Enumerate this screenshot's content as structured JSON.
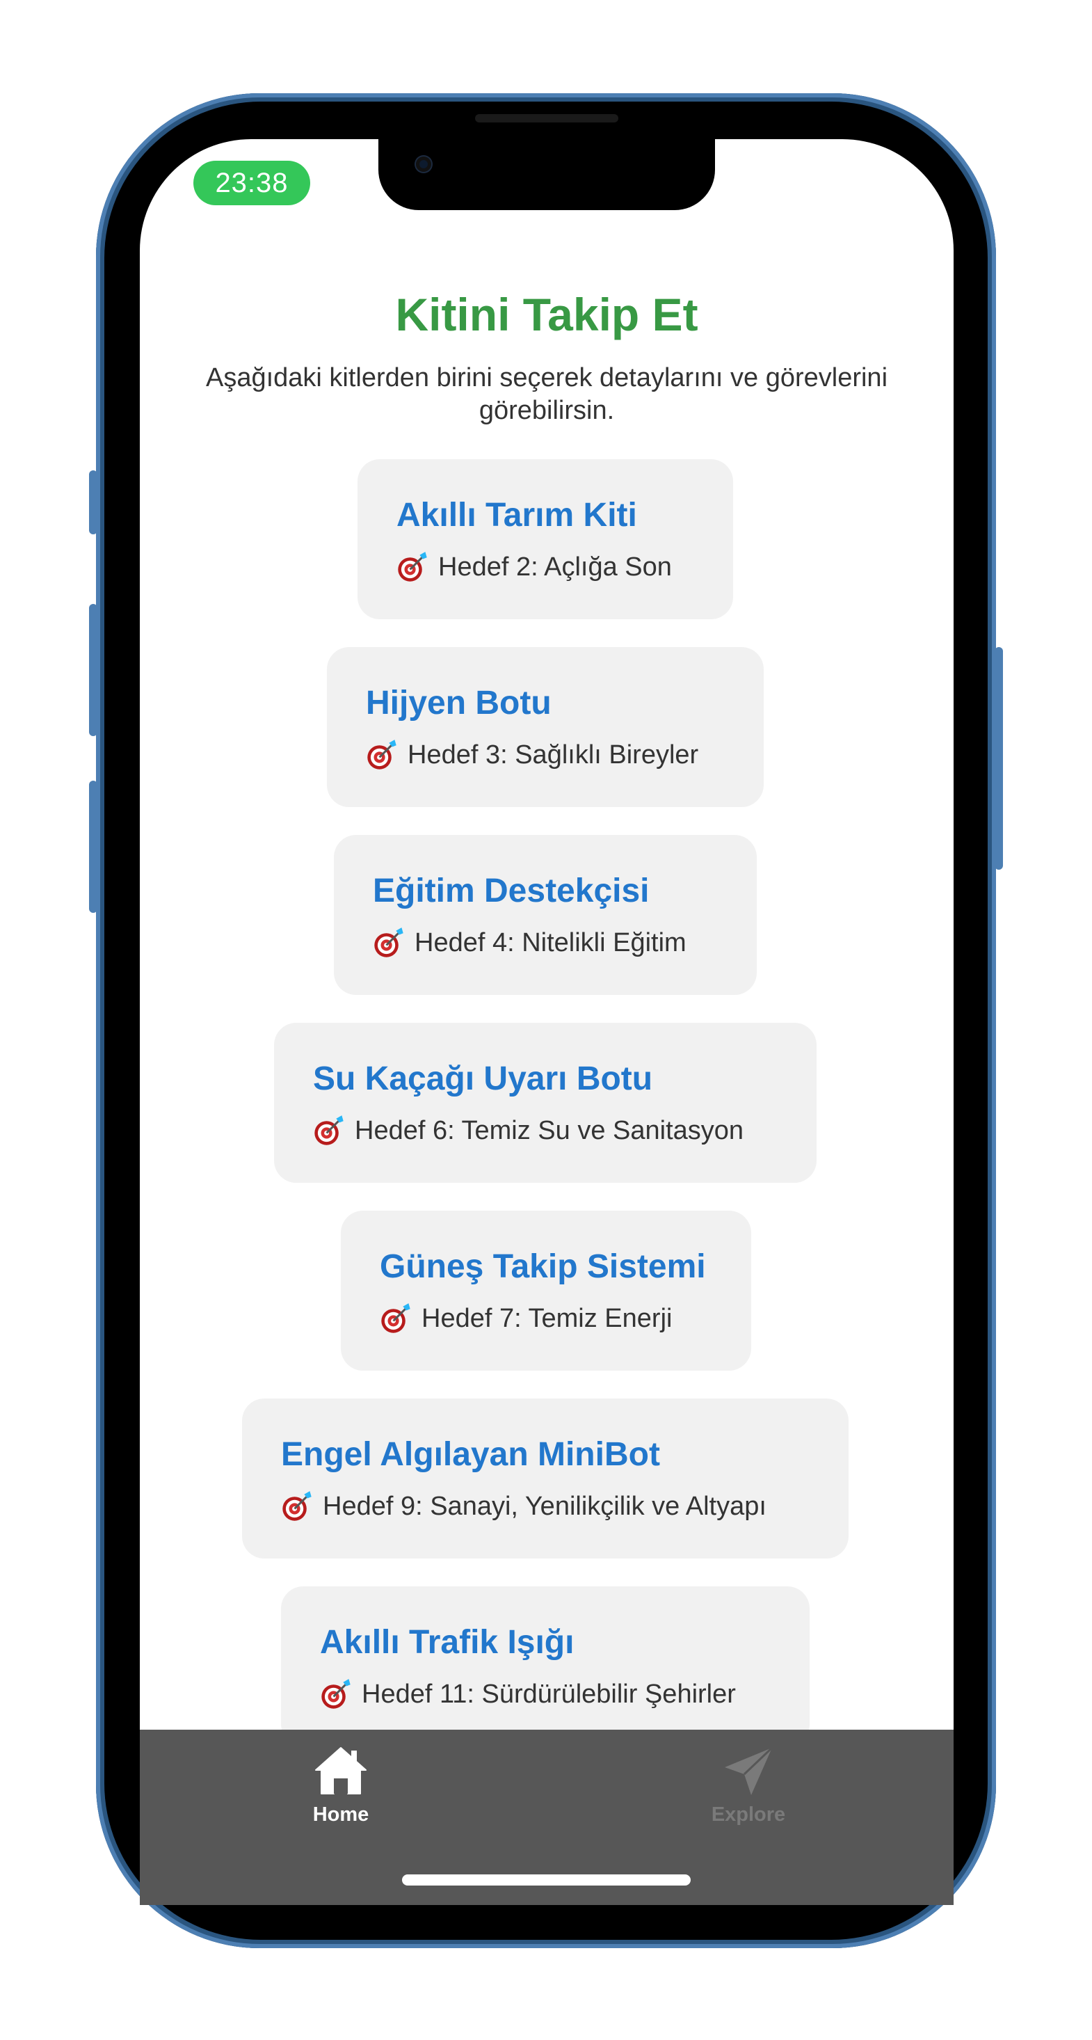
{
  "status_bar": {
    "time": "23:38"
  },
  "header": {
    "title": "Kitini Takip Et",
    "subtitle": "Aşağıdaki kitlerden birini seçerek detaylarını ve görevlerini görebilirsin."
  },
  "kits": [
    {
      "name": "Akıllı Tarım Kiti",
      "goal": "Hedef 2: Açlığa Son"
    },
    {
      "name": "Hijyen Botu",
      "goal": "Hedef 3: Sağlıklı Bireyler"
    },
    {
      "name": "Eğitim Destekçisi",
      "goal": "Hedef 4: Nitelikli Eğitim"
    },
    {
      "name": "Su Kaçağı Uyarı Botu",
      "goal": "Hedef 6: Temiz Su ve Sanitasyon"
    },
    {
      "name": "Güneş Takip Sistemi",
      "goal": "Hedef 7: Temiz Enerji"
    },
    {
      "name": "Engel Algılayan MiniBot",
      "goal": "Hedef 9: Sanayi, Yenilikçilik ve Altyapı"
    },
    {
      "name": "Akıllı Trafik Işığı",
      "goal": "Hedef 11: Sürdürülebilir Şehirler"
    }
  ],
  "tab_bar": {
    "tabs": [
      {
        "label": "Home",
        "icon": "home-icon",
        "active": true
      },
      {
        "label": "Explore",
        "icon": "paper-plane-icon",
        "active": false
      }
    ],
    "active_color": "#ffffff",
    "inactive_color": "#7a7a7a"
  },
  "colors": {
    "title": "#389944",
    "kit_name": "#2277cc",
    "card_bg": "#f1f1f1",
    "status_pill": "#34c759",
    "tab_bar_bg": "#575757"
  }
}
